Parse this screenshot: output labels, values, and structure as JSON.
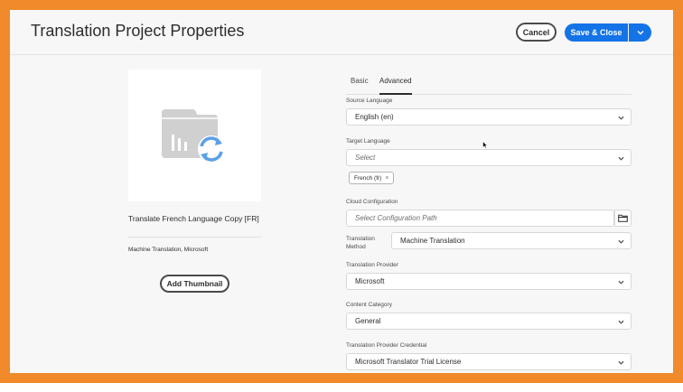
{
  "header": {
    "title": "Translation Project Properties",
    "cancel_label": "Cancel",
    "save_label": "Save & Close"
  },
  "project": {
    "title": "Translate French Language Copy [FR]",
    "subtitle": "Machine Translation, Microsoft",
    "add_thumbnail_label": "Add Thumbnail"
  },
  "tabs": [
    {
      "label": "Basic",
      "active": false
    },
    {
      "label": "Advanced",
      "active": true
    }
  ],
  "form": {
    "source_language": {
      "label": "Source Language",
      "value": "English (en)"
    },
    "target_language": {
      "label": "Target Language",
      "placeholder": "Select",
      "tags": [
        "French (fr)"
      ]
    },
    "cloud_configuration": {
      "label": "Cloud Configuration",
      "placeholder": "Select Configuration Path"
    },
    "translation_method": {
      "label": "Translation Method",
      "value": "Machine Translation"
    },
    "translation_provider": {
      "label": "Translation Provider",
      "value": "Microsoft"
    },
    "content_category": {
      "label": "Content Category",
      "value": "General"
    },
    "provider_credential": {
      "label": "Translation Provider Credential",
      "value": "Microsoft Translator Trial License"
    }
  },
  "colors": {
    "frame": "#f08a2a",
    "accent": "#1473e6",
    "thumbnail_icon": "#d0d0d0",
    "sync_icon": "#5aa0e8"
  },
  "icons": {
    "thumbnail": "folder-sync-icon",
    "chevron": "chevron-down-icon",
    "browse": "folder-icon",
    "tag_remove": "close-icon"
  }
}
